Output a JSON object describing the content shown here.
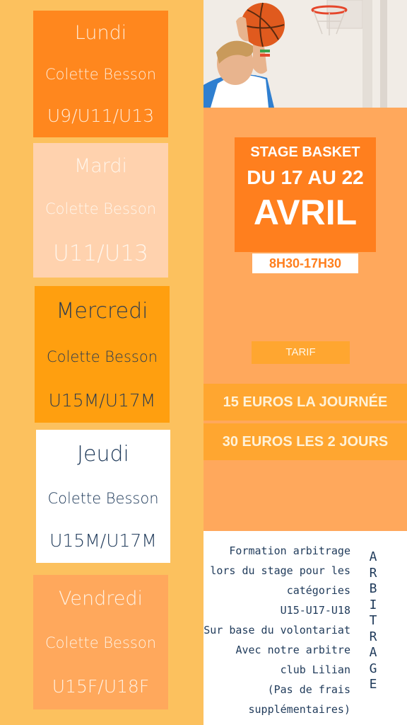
{
  "days": [
    {
      "name": "Lundi",
      "coach": "Colette Besson",
      "groups": "U9/U11/U13"
    },
    {
      "name": "Mardi",
      "coach": "Colette Besson",
      "groups": "U11/U13"
    },
    {
      "name": "Mercredi",
      "coach": "Colette Besson",
      "groups": "U15M/U17M"
    },
    {
      "name": "Jeudi",
      "coach": "Colette Besson",
      "groups": "U15M/U17M"
    },
    {
      "name": "Vendredi",
      "coach": "Colette Besson",
      "groups": "U15F/U18F"
    }
  ],
  "stage": {
    "line1": "STAGE BASKET",
    "line2": "DU 17 AU 22",
    "line3": "AVRIL",
    "hours": "8H30-17H30"
  },
  "tarif": {
    "label": "TARIF",
    "day_price": "15 EUROS LA JOURNÉE",
    "two_days_price": "30 EUROS LES 2 JOURS"
  },
  "arbitrage": {
    "lines": [
      "Formation arbitrage",
      "lors du stage pour les",
      "catégories",
      "U15-U17-U18",
      "Sur base du volontariat",
      "Avec notre arbitre",
      "club Lilian",
      "(Pas de frais",
      "supplémentaires)"
    ],
    "vertical": "ARBITRAGE"
  },
  "colors": {
    "background": "#fcc15e",
    "panel": "#ffa85c",
    "title_box": "#ff7f1e",
    "text_dark": "#1f3a5a"
  }
}
